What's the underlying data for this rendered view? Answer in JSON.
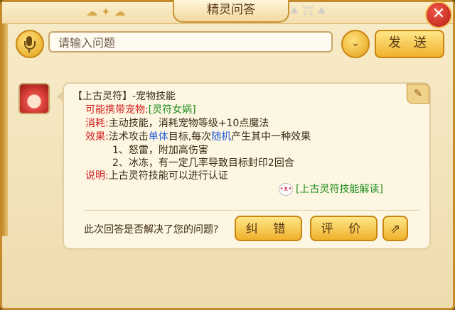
{
  "window": {
    "title": "精灵问答",
    "close_icon": "close-icon"
  },
  "search": {
    "placeholder": "请输入问题",
    "value": "",
    "mic_icon": "microphone-icon",
    "dropdown_icon": "chevron-down-icon",
    "send_label": "发 送"
  },
  "answer": {
    "heading": "【上古灵符】-宠物技能",
    "rows": {
      "pet_label": "可能携带宠物:",
      "pet_value": "[灵符女娲]",
      "cost_label": "消耗:",
      "cost_value": "主动技能，消耗宠物等级+10点魔法",
      "effect_label": "效果:",
      "effect_pre": "法术攻击",
      "effect_single": "单体",
      "effect_mid": "目标,每次",
      "effect_random": "随机",
      "effect_post": "产生其中一种效果",
      "effect_1": "1、怒雷，附加高伤害",
      "effect_2": "2、冰冻，有一定几率导致目标封印2回合",
      "note_label": "说明:",
      "note_value": "上古灵符技能可以进行认证"
    },
    "detail_link": "[上古灵符技能解读]",
    "scroll_icon": "scroll-icon"
  },
  "feedback": {
    "question": "此次回答是否解决了您的问题?",
    "correct_label": "纠 错",
    "rate_label": "评 价",
    "share_icon": "share-icon"
  }
}
